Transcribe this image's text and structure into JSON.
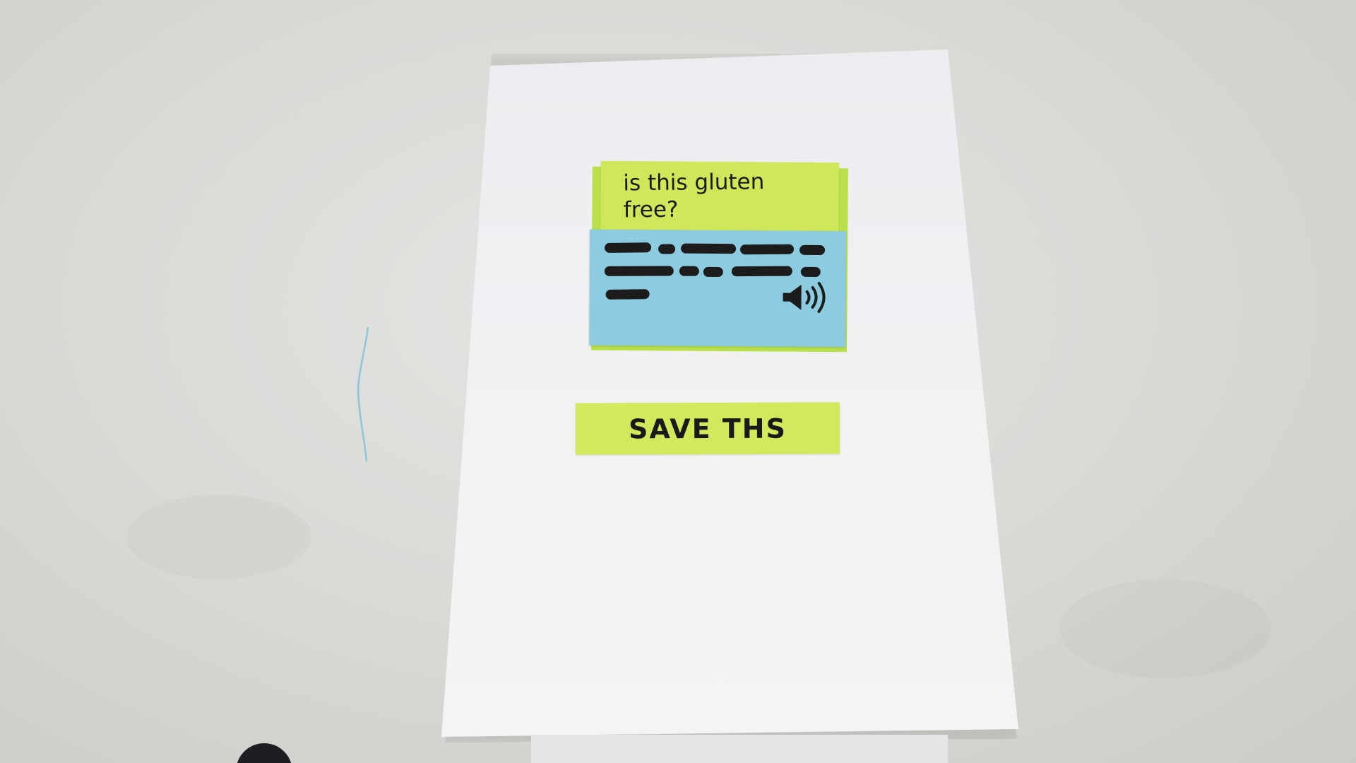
{
  "question_note": {
    "text": "is this gluten free?",
    "color": "#cfe85a"
  },
  "answer_note": {
    "color": "#8ccbe0",
    "speaker_icon": "speaker-volume-icon"
  },
  "save_button": {
    "label": "SAVE THS",
    "color": "#d2e95c"
  }
}
